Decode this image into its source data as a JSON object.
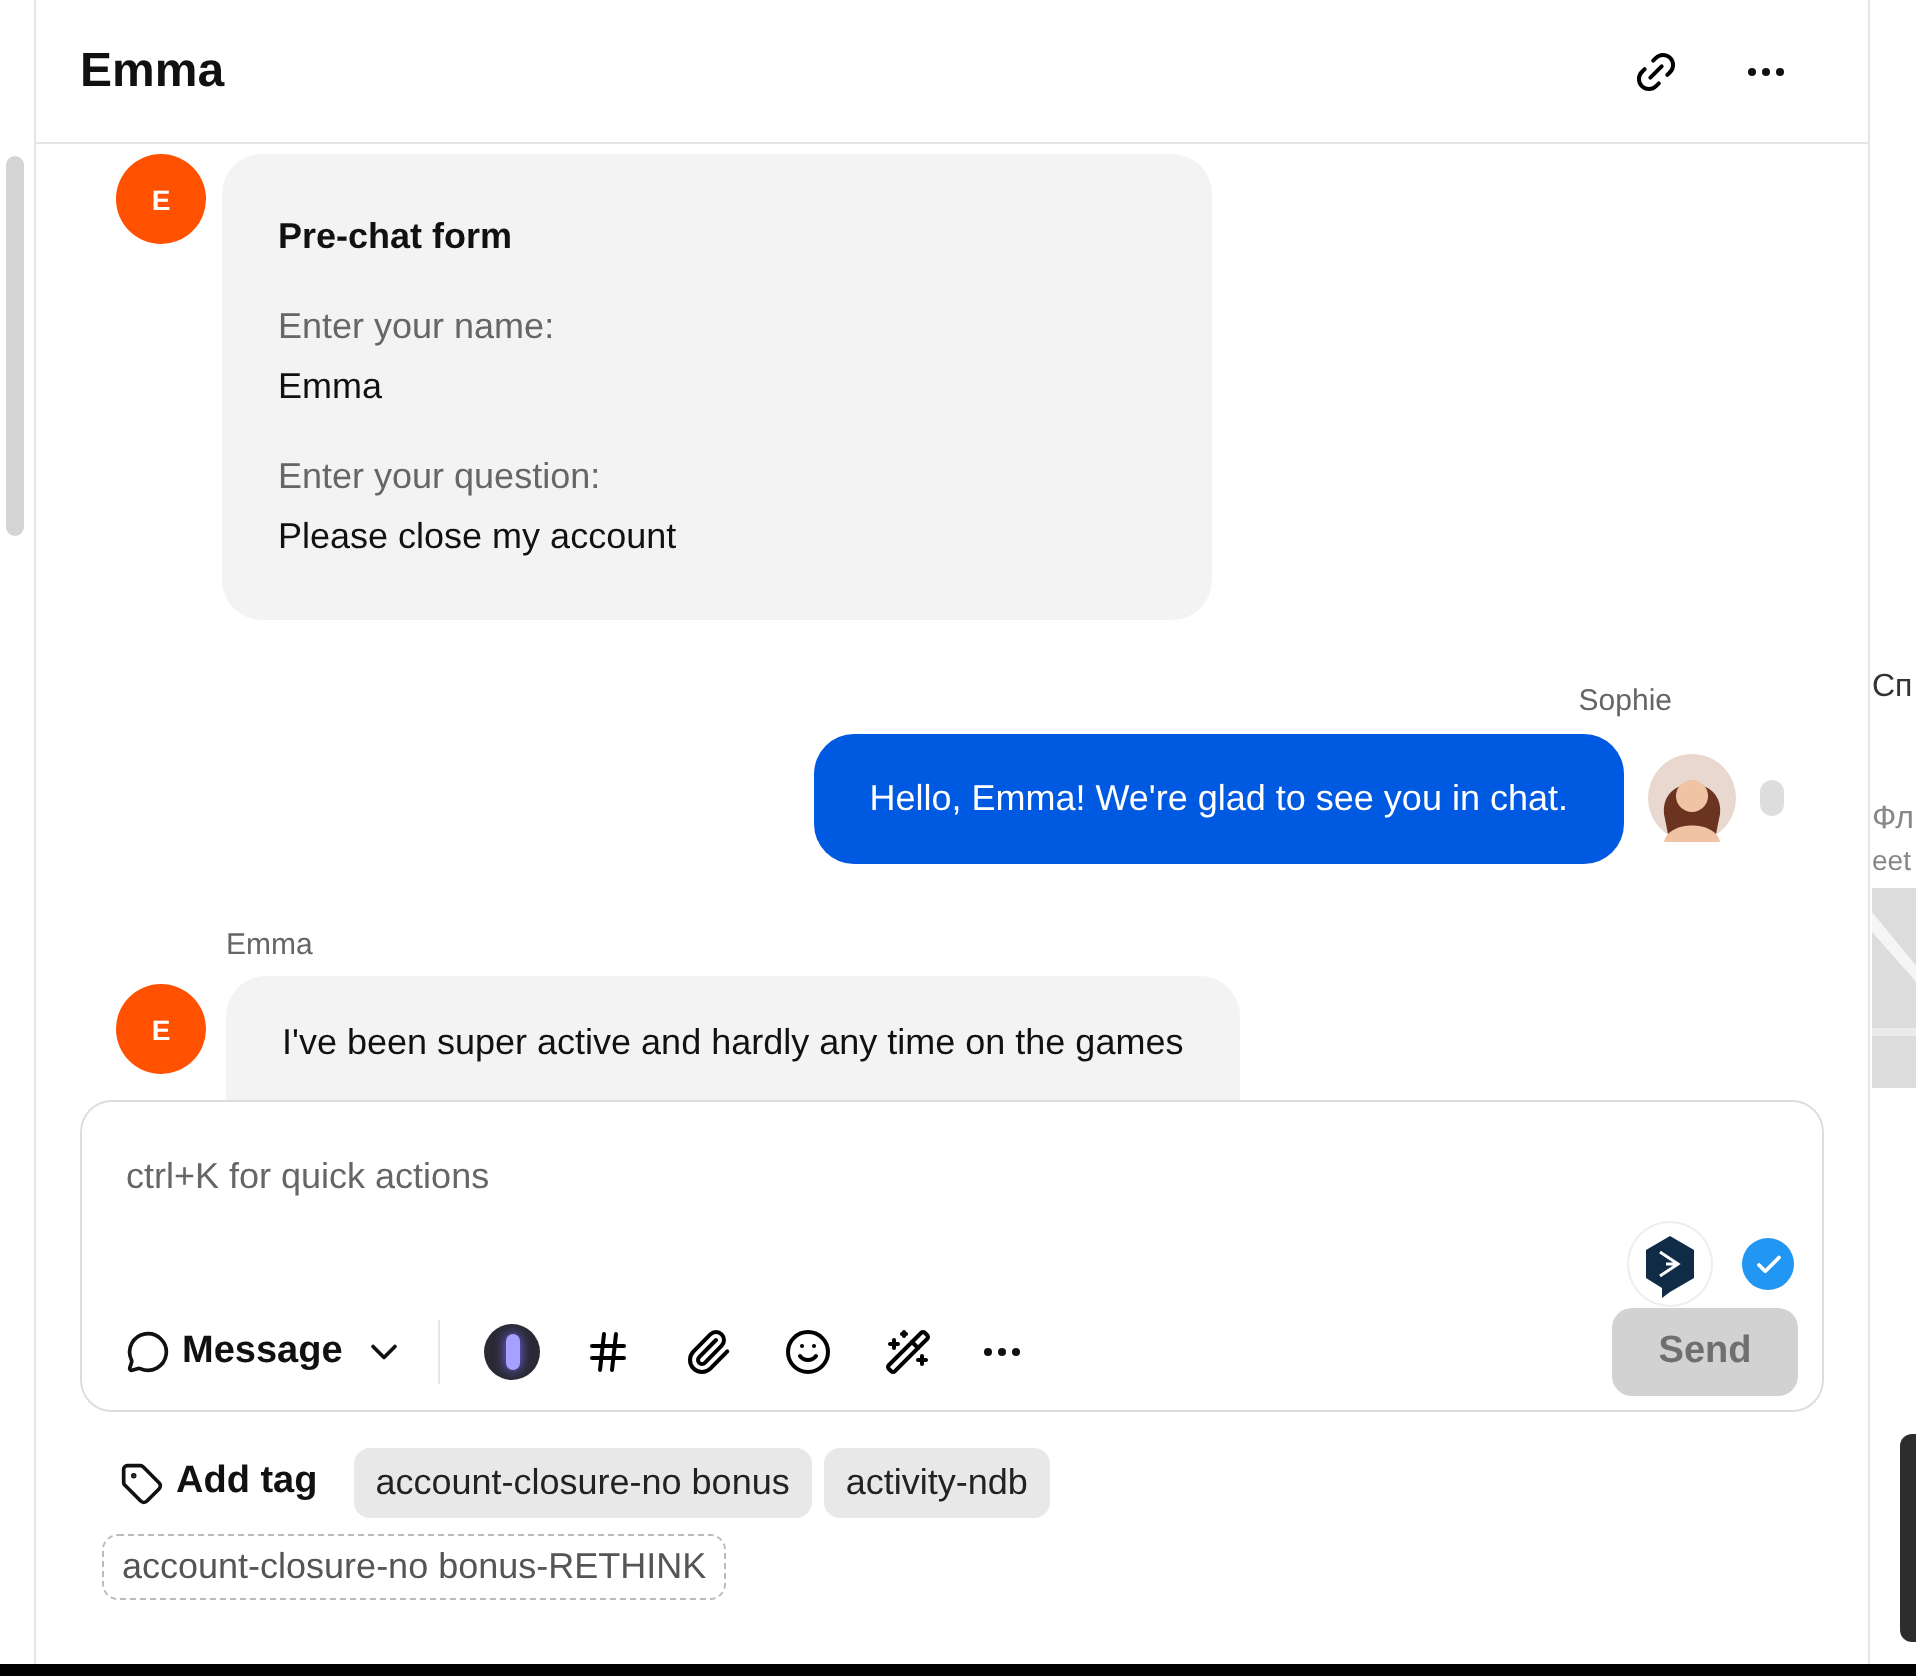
{
  "header": {
    "title": "Emma"
  },
  "messages": [
    {
      "kind": "form",
      "avatar": "E",
      "title": "Pre-chat form",
      "fields": [
        {
          "label": "Enter your name:",
          "value": "Emma"
        },
        {
          "label": "Enter your question:",
          "value": "Please close my account"
        }
      ]
    },
    {
      "kind": "agent",
      "author": "Sophie",
      "text": "Hello, Emma! We're glad to see you in chat."
    },
    {
      "kind": "visitor",
      "author": "Emma",
      "avatar": "E",
      "text": "I've been super active and hardly any time on the games"
    }
  ],
  "composer": {
    "placeholder": "ctrl+K for quick actions",
    "mode": "Message",
    "send": "Send",
    "send_disabled": true
  },
  "tags": {
    "add": "Add tag",
    "items": [
      {
        "label": "account-closure-no bonus",
        "kind": "applied"
      },
      {
        "label": "activity-ndb",
        "kind": "applied"
      },
      {
        "label": "account-closure-no bonus-RETHINK",
        "kind": "suggested"
      }
    ]
  },
  "side_panel": {
    "texts": [
      "Сп",
      "Фл",
      "eet"
    ]
  }
}
